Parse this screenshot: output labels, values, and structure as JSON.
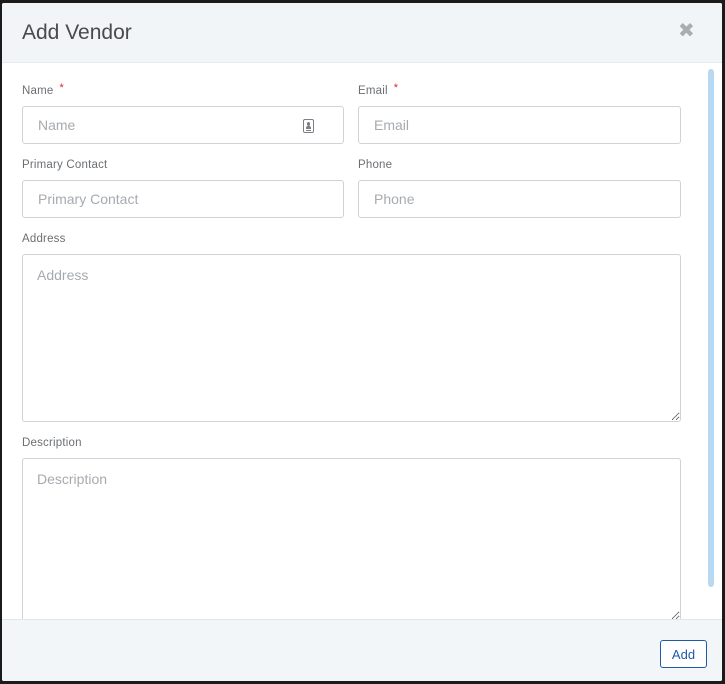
{
  "modal": {
    "title": "Add Vendor",
    "close_icon_glyph": "✖"
  },
  "form": {
    "name": {
      "label": "Name",
      "required_mark": "*",
      "placeholder": "Name",
      "value": ""
    },
    "email": {
      "label": "Email",
      "required_mark": "*",
      "placeholder": "Email",
      "value": ""
    },
    "primary_contact": {
      "label": "Primary Contact",
      "placeholder": "Primary Contact",
      "value": ""
    },
    "phone": {
      "label": "Phone",
      "placeholder": "Phone",
      "value": ""
    },
    "address": {
      "label": "Address",
      "placeholder": "Address",
      "value": ""
    },
    "description": {
      "label": "Description",
      "placeholder": "Description",
      "value": ""
    }
  },
  "footer": {
    "add_label": "Add"
  },
  "icons": {
    "name_field_icon": "contact-card-icon",
    "close": "close-icon"
  },
  "colors": {
    "accent": "#1f5aa6",
    "required": "#e0262b",
    "header_bg": "#f1f5f8",
    "scrollbar": "#b7d9f3"
  }
}
